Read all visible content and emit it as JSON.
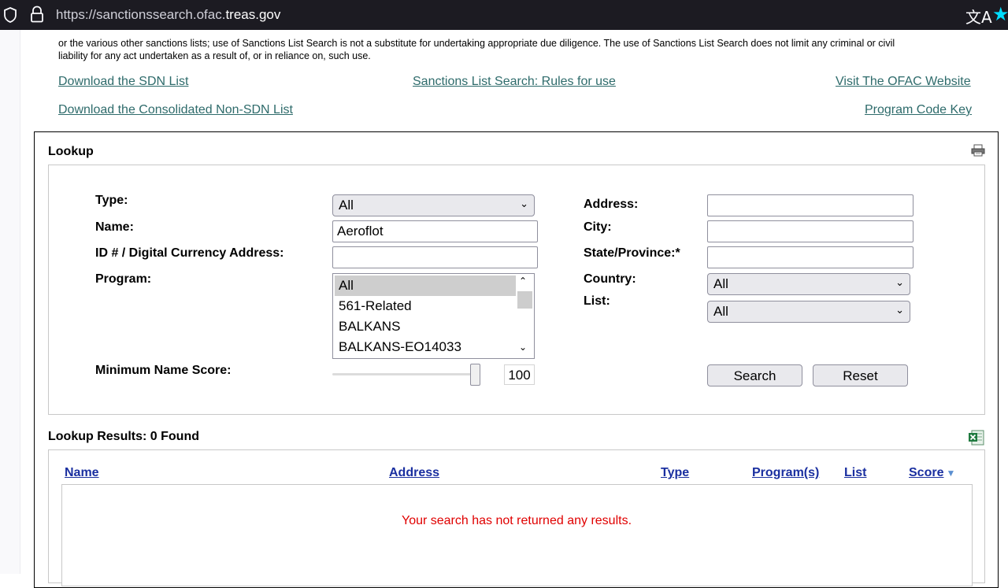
{
  "browser": {
    "url_prefix": "https://sanctionssearch.ofac.",
    "url_domain": "treas.gov",
    "translate_glyph": "文A",
    "star_glyph": "★"
  },
  "disclaimer": {
    "line1": "or the various other sanctions lists; use of Sanctions List Search is not a substitute for undertaking appropriate due diligence. The use of Sanctions List Search does not limit any criminal or civil",
    "line2": "liability for any act undertaken as a result of, or in reliance on, such use."
  },
  "links": {
    "download_sdn": "Download the SDN List",
    "rules": "Sanctions List Search: Rules for use",
    "visit_ofac": "Visit The OFAC Website",
    "download_consolidated": "Download the Consolidated Non-SDN List",
    "program_key": "Program Code Key"
  },
  "lookup": {
    "title": "Lookup",
    "type_label": "Type:",
    "type_value": "All",
    "name_label": "Name:",
    "name_value": "Aeroflot",
    "id_label": "ID # / Digital Currency Address:",
    "id_value": "",
    "program_label": "Program:",
    "program_options": [
      "All",
      "561-Related",
      "BALKANS",
      "BALKANS-EO14033"
    ],
    "program_selected": "All",
    "min_score_label": "Minimum Name Score:",
    "min_score_value": "100",
    "min_score_fraction": 1.0,
    "address_label": "Address:",
    "address_value": "",
    "city_label": "City:",
    "city_value": "",
    "state_label": "State/Province:*",
    "state_value": "",
    "country_label": "Country:",
    "country_value": "All",
    "list_label": "List:",
    "list_value": "All",
    "search_button": "Search",
    "reset_button": "Reset"
  },
  "results": {
    "title": "Lookup Results: 0 Found",
    "columns": {
      "name": "Name",
      "address": "Address",
      "type": "Type",
      "programs": "Program(s)",
      "list": "List",
      "score": "Score"
    },
    "sort_indicator": "▼",
    "empty_message": "Your search has not returned any results."
  },
  "colors": {
    "link": "#2e6b6b",
    "column_header": "#1a2fa0",
    "error_text": "#e00000",
    "browser_bar": "#1c1b22"
  }
}
